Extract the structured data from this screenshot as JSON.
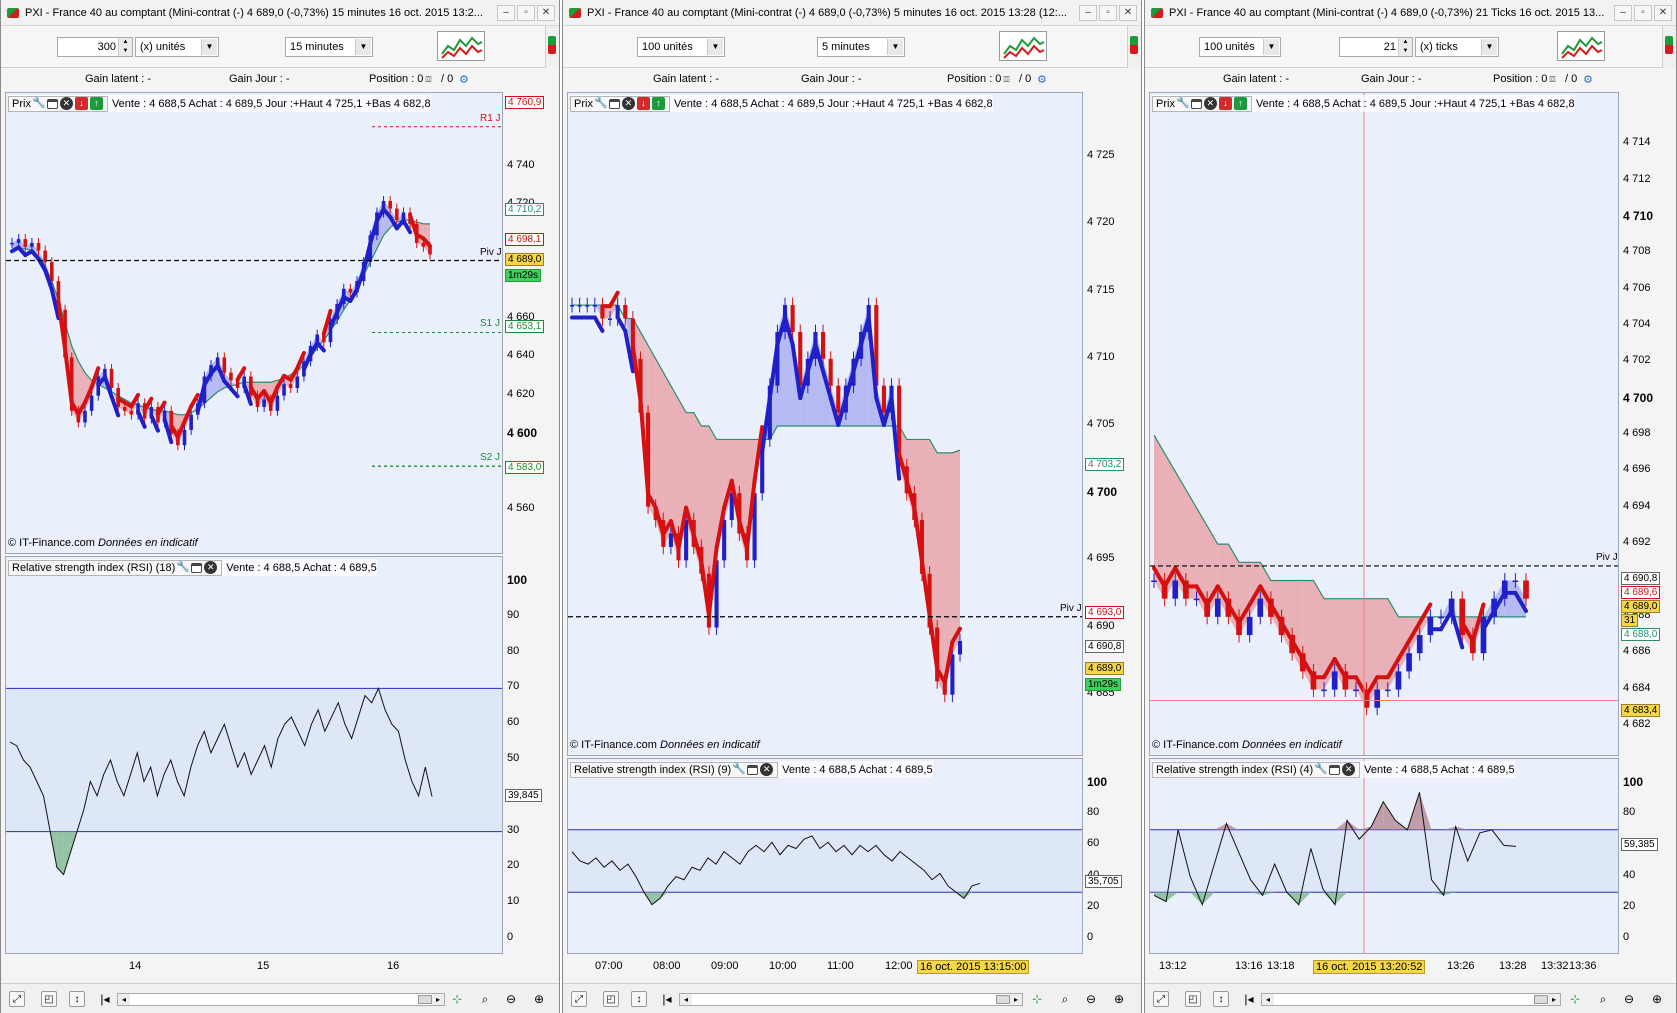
{
  "colors": {
    "up": "#2020c8",
    "down": "#d41010",
    "fill_red": "#e8a0a8",
    "fill_blue": "#a8aef0",
    "ma": "#2c8c6c",
    "pane_bg": "#eaf0fb"
  },
  "windows": [
    {
      "id": "w1",
      "title": "PXI - France 40 au comptant (Mini-contrat  (-)    4 689,0 (-0,73%)    15 minutes  16 oct. 2015 13:2...",
      "qty_spin": "300",
      "qty_unit": "(x) unités",
      "period": "15 minutes",
      "pos": {
        "gain_latent": "Gain latent : -",
        "gain_jour": "Gain Jour : -",
        "position": "Position : 0",
        "slash": "/ 0"
      },
      "legend": {
        "prix": "Prix",
        "quote": "Vente : 4 688,5 Achat : 4 689,5 Jour :+Haut 4 725,1 +Bas 4 682,8"
      },
      "copyright": "© IT-Finance.com",
      "copyright2": "Données en indicatif",
      "rsi_legend": {
        "name": "Relative strength index (RSI) (18)",
        "quote": "Vente : 4 688,5 Achat : 4 689,5"
      },
      "price_ticks": [
        "4 740",
        "4 720",
        "4 700",
        "4 680",
        "4 660",
        "4 640",
        "4 620",
        "4 600",
        "4 580",
        "4 560"
      ],
      "price_ticks_bold": [
        "4 600"
      ],
      "labels": [
        {
          "text": "4 760,9",
          "kind": "r1"
        },
        {
          "text": "4 710,2",
          "kind": "ma"
        },
        {
          "text": "4 698,1",
          "kind": "red"
        },
        {
          "text": "4 689,0",
          "kind": "yellow"
        },
        {
          "text": "1m29s",
          "kind": "green"
        },
        {
          "text": "4 653,1",
          "kind": "s"
        },
        {
          "text": "4 583,0",
          "kind": "s"
        }
      ],
      "lines": [
        {
          "text": "R1 J",
          "kind": "r1"
        },
        {
          "text": "Piv J",
          "kind": "piv"
        },
        {
          "text": "S1 J",
          "kind": "s"
        },
        {
          "text": "S2 J",
          "kind": "s"
        }
      ],
      "rsi_ticks": [
        "100",
        "90",
        "80",
        "70",
        "60",
        "50",
        "40",
        "30",
        "20",
        "10",
        "0"
      ],
      "rsi_value": "39,845",
      "time_ticks": [
        "14",
        "15",
        "16"
      ]
    },
    {
      "id": "w2",
      "title": "PXI - France 40 au comptant (Mini-contrat  (-)    4 689,0 (-0,73%)    5 minutes  16 oct. 2015 13:28 (12:...",
      "qty_select": "100 unités",
      "period": "5 minutes",
      "pos": {
        "gain_latent": "Gain latent : -",
        "gain_jour": "Gain Jour : -",
        "position": "Position : 0",
        "slash": "/ 0"
      },
      "legend": {
        "prix": "Prix",
        "quote": "Vente : 4 688,5 Achat : 4 689,5 Jour :+Haut 4 725,1 +Bas 4 682,8"
      },
      "copyright": "© IT-Finance.com",
      "copyright2": "Données en indicatif",
      "rsi_legend": {
        "name": "Relative strength index (RSI) (9)",
        "quote": "Vente : 4 688,5 Achat : 4 689,5"
      },
      "price_ticks": [
        "4 725",
        "4 720",
        "4 715",
        "4 710",
        "4 705",
        "4 700",
        "4 695",
        "4 690",
        "4 685"
      ],
      "price_ticks_bold": [
        "4 700"
      ],
      "labels": [
        {
          "text": "4 703,2",
          "kind": "ma"
        },
        {
          "text": "4 693,0",
          "kind": "red"
        },
        {
          "text": "4 690,8",
          "kind": "plain"
        },
        {
          "text": "4 689,0",
          "kind": "yellow"
        },
        {
          "text": "1m29s",
          "kind": "green"
        }
      ],
      "lines": [
        {
          "text": "Piv J",
          "kind": "piv"
        }
      ],
      "rsi_ticks": [
        "100",
        "80",
        "60",
        "40",
        "20",
        "0"
      ],
      "rsi_value": "35,705",
      "time_ticks": [
        "07:00",
        "08:00",
        "09:00",
        "10:00",
        "11:00",
        "12:00"
      ],
      "time_highlight": "16 oct. 2015 13:15:00"
    },
    {
      "id": "w3",
      "title": "PXI - France 40 au comptant (Mini-contrat  (-)    4 689,0 (-0,73%)    21 Ticks  16 oct. 2015 13...",
      "qty_select": "100 unités",
      "qty_spin": "21",
      "qty_unit": "(x) ticks",
      "pos": {
        "gain_latent": "Gain latent : -",
        "gain_jour": "Gain Jour : -",
        "position": "Position : 0",
        "slash": "/ 0"
      },
      "legend": {
        "prix": "Prix",
        "quote": "Vente : 4 688,5 Achat : 4 689,5 Jour :+Haut 4 725,1 +Bas 4 682,8"
      },
      "copyright": "© IT-Finance.com",
      "copyright2": "Données en indicatif",
      "rsi_legend": {
        "name": "Relative strength index (RSI) (4)",
        "quote": "Vente : 4 688,5 Achat : 4 689,5"
      },
      "price_ticks": [
        "4 714",
        "4 712",
        "4 710",
        "4 708",
        "4 706",
        "4 704",
        "4 702",
        "4 700",
        "4 698",
        "4 696",
        "4 694",
        "4 692",
        "4 690",
        "4 688",
        "4 686",
        "4 684",
        "4 682"
      ],
      "price_ticks_bold": [
        "4 710",
        "4 700"
      ],
      "labels": [
        {
          "text": "4 690,8",
          "kind": "plain"
        },
        {
          "text": "4 689,6",
          "kind": "red"
        },
        {
          "text": "4 689,0",
          "kind": "yellow"
        },
        {
          "text": "31",
          "kind": "yellowsm"
        },
        {
          "text": "4 688,0",
          "kind": "ma"
        },
        {
          "text": "4 683,4",
          "kind": "yellow"
        }
      ],
      "lines": [
        {
          "text": "Piv J",
          "kind": "piv"
        }
      ],
      "rsi_ticks": [
        "100",
        "80",
        "60",
        "40",
        "20",
        "0"
      ],
      "rsi_value": "59,385",
      "time_ticks": [
        "13:12",
        "13:16",
        "13:18",
        "13:26",
        "13:28",
        "13:32",
        "13:36"
      ],
      "time_highlight": "16 oct. 2015 13:20:52"
    }
  ],
  "chart_data": [
    {
      "type": "candlestick",
      "window": "15 minutes",
      "y_ticks": [
        4560,
        4580,
        4600,
        4620,
        4640,
        4660,
        4680,
        4700,
        4720,
        4740
      ],
      "ylim": [
        4548,
        4766
      ],
      "close_series": [
        4700,
        4702,
        4698,
        4700,
        4696,
        4690,
        4680,
        4665,
        4640,
        4612,
        4606,
        4612,
        4620,
        4630,
        4634,
        4624,
        4614,
        4612,
        4610,
        4616,
        4608,
        4614,
        4606,
        4612,
        4600,
        4594,
        4602,
        4610,
        4616,
        4630,
        4636,
        4640,
        4632,
        4628,
        4624,
        4630,
        4620,
        4614,
        4618,
        4612,
        4620,
        4626,
        4624,
        4630,
        4638,
        4646,
        4652,
        4648,
        4660,
        4668,
        4676,
        4674,
        4680,
        4690,
        4704,
        4716,
        4722,
        4718,
        4712,
        4716,
        4710,
        4700,
        4698,
        4694
      ],
      "ma_series": [
        4696,
        4697,
        4697,
        4696,
        4693,
        4688,
        4680,
        4670,
        4658,
        4646,
        4638,
        4632,
        4628,
        4626,
        4624,
        4622,
        4620,
        4618,
        4616,
        4615,
        4614,
        4613,
        4612,
        4612,
        4611,
        4610,
        4610,
        4611,
        4613,
        4616,
        4619,
        4622,
        4624,
        4625,
        4626,
        4627,
        4627,
        4627,
        4627,
        4627,
        4628,
        4629,
        4631,
        4633,
        4636,
        4640,
        4645,
        4649,
        4654,
        4659,
        4665,
        4670,
        4676,
        4683,
        4690,
        4697,
        4704,
        4708,
        4711,
        4712,
        4712,
        4711,
        4710,
        4710
      ],
      "pivots": {
        "R1": 4760.9,
        "Piv": 4690.8,
        "S1": 4653.1,
        "S2": 4583.0
      },
      "rsi_ylim": [
        0,
        100
      ],
      "rsi_levels": [
        70,
        30
      ],
      "rsi_series": [
        55,
        54,
        50,
        48,
        44,
        40,
        30,
        20,
        18,
        24,
        30,
        36,
        44,
        40,
        46,
        50,
        44,
        40,
        46,
        52,
        44,
        48,
        40,
        46,
        50,
        44,
        40,
        48,
        54,
        58,
        52,
        56,
        60,
        54,
        48,
        52,
        46,
        50,
        54,
        48,
        56,
        60,
        62,
        58,
        54,
        60,
        64,
        58,
        62,
        66,
        60,
        56,
        62,
        68,
        66,
        70,
        64,
        60,
        58,
        50,
        44,
        40,
        48,
        39.8
      ]
    },
    {
      "type": "candlestick",
      "window": "5 minutes",
      "y_ticks": [
        4685,
        4690,
        4695,
        4700,
        4705,
        4710,
        4715,
        4720,
        4725
      ],
      "ylim": [
        4682,
        4728
      ],
      "close_series": [
        4714,
        4714,
        4714,
        4714,
        4713,
        4713,
        4714,
        4713,
        4710,
        4706,
        4699,
        4698,
        4696,
        4697,
        4695,
        4698,
        4696,
        4694,
        4690,
        4695,
        4698,
        4700,
        4697,
        4695,
        4700,
        4704,
        4708,
        4712,
        4714,
        4712,
        4708,
        4710,
        4712,
        4710,
        4708,
        4706,
        4708,
        4710,
        4712,
        4714,
        4708,
        4706,
        4708,
        4702,
        4700,
        4698,
        4694,
        4690,
        4686,
        4685,
        4688,
        4689
      ],
      "ma_series": [
        4714,
        4714,
        4714,
        4714,
        4714,
        4714,
        4714,
        4713,
        4713,
        4712,
        4711,
        4710,
        4709,
        4708,
        4707,
        4706,
        4706,
        4705,
        4705,
        4704,
        4704,
        4704,
        4704,
        4704,
        4704,
        4704,
        4704,
        4705,
        4705,
        4705,
        4705,
        4705,
        4705,
        4705,
        4705,
        4705,
        4705,
        4705,
        4705,
        4705,
        4705,
        4705,
        4705,
        4705,
        4704,
        4704,
        4704,
        4704,
        4703,
        4703,
        4703,
        4703.2
      ],
      "pivot": 4690.8,
      "rsi_ylim": [
        0,
        100
      ],
      "rsi_levels": [
        70,
        30
      ],
      "rsi_series": [
        56,
        50,
        48,
        52,
        46,
        50,
        44,
        48,
        40,
        30,
        22,
        26,
        34,
        40,
        38,
        46,
        44,
        52,
        48,
        56,
        52,
        48,
        56,
        60,
        56,
        62,
        54,
        60,
        58,
        64,
        66,
        58,
        62,
        56,
        60,
        54,
        60,
        56,
        60,
        54,
        50,
        56,
        52,
        48,
        44,
        38,
        42,
        34,
        30,
        26,
        34,
        35.7
      ]
    },
    {
      "type": "candlestick",
      "window": "21 Ticks",
      "y_ticks": [
        4682,
        4684,
        4686,
        4688,
        4690,
        4692,
        4694,
        4696,
        4698,
        4700,
        4702,
        4704,
        4706,
        4708,
        4710,
        4712,
        4714
      ],
      "ylim": [
        4681.5,
        4715.5
      ],
      "close_series": [
        4690,
        4689,
        4690,
        4689,
        4689,
        4688,
        4689,
        4688,
        4687,
        4688,
        4689,
        4688,
        4687,
        4686,
        4685,
        4684,
        4684,
        4685,
        4684,
        4684,
        4683,
        4684,
        4684,
        4685,
        4686,
        4687,
        4688,
        4688,
        4689,
        4687,
        4686,
        4688,
        4689,
        4690,
        4690,
        4689
      ],
      "ma_series": [
        4698,
        4697,
        4696,
        4695,
        4694,
        4693,
        4692,
        4692,
        4691,
        4691,
        4691,
        4690,
        4690,
        4690,
        4690,
        4690,
        4689,
        4689,
        4689,
        4689,
        4689,
        4689,
        4689,
        4688,
        4688,
        4688,
        4688,
        4688,
        4688,
        4688,
        4688,
        4688,
        4688,
        4688,
        4688,
        4688
      ],
      "pivot": 4690.8,
      "rsi_ylim": [
        0,
        100
      ],
      "rsi_levels": [
        70,
        30
      ],
      "rsi_series": [
        28,
        24,
        70,
        40,
        22,
        48,
        74,
        56,
        38,
        28,
        48,
        30,
        22,
        58,
        32,
        22,
        76,
        64,
        72,
        88,
        76,
        70,
        94,
        38,
        28,
        72,
        50,
        68,
        70,
        60,
        59.4
      ]
    }
  ]
}
